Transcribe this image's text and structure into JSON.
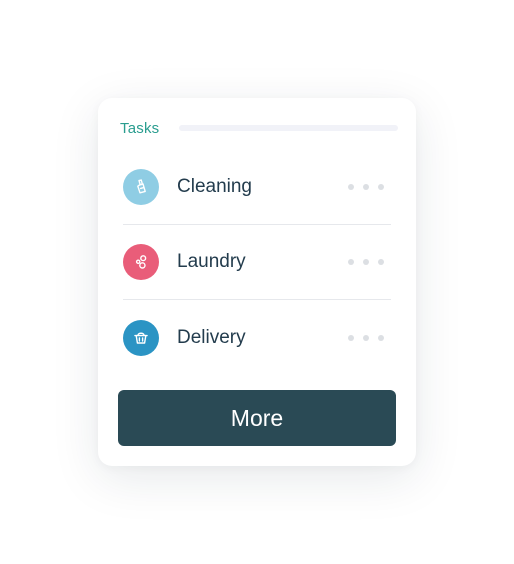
{
  "card": {
    "title": "Tasks"
  },
  "tasks": [
    {
      "label": "Cleaning",
      "icon": "broom-icon",
      "color": "#8fcde4"
    },
    {
      "label": "Laundry",
      "icon": "bubbles-icon",
      "color": "#e95d79"
    },
    {
      "label": "Delivery",
      "icon": "basket-icon",
      "color": "#2b94c4"
    }
  ],
  "more_button": {
    "label": "More",
    "color": "#2a4a55"
  },
  "colors": {
    "accent": "#2a9d8f",
    "text": "#233c4d"
  }
}
